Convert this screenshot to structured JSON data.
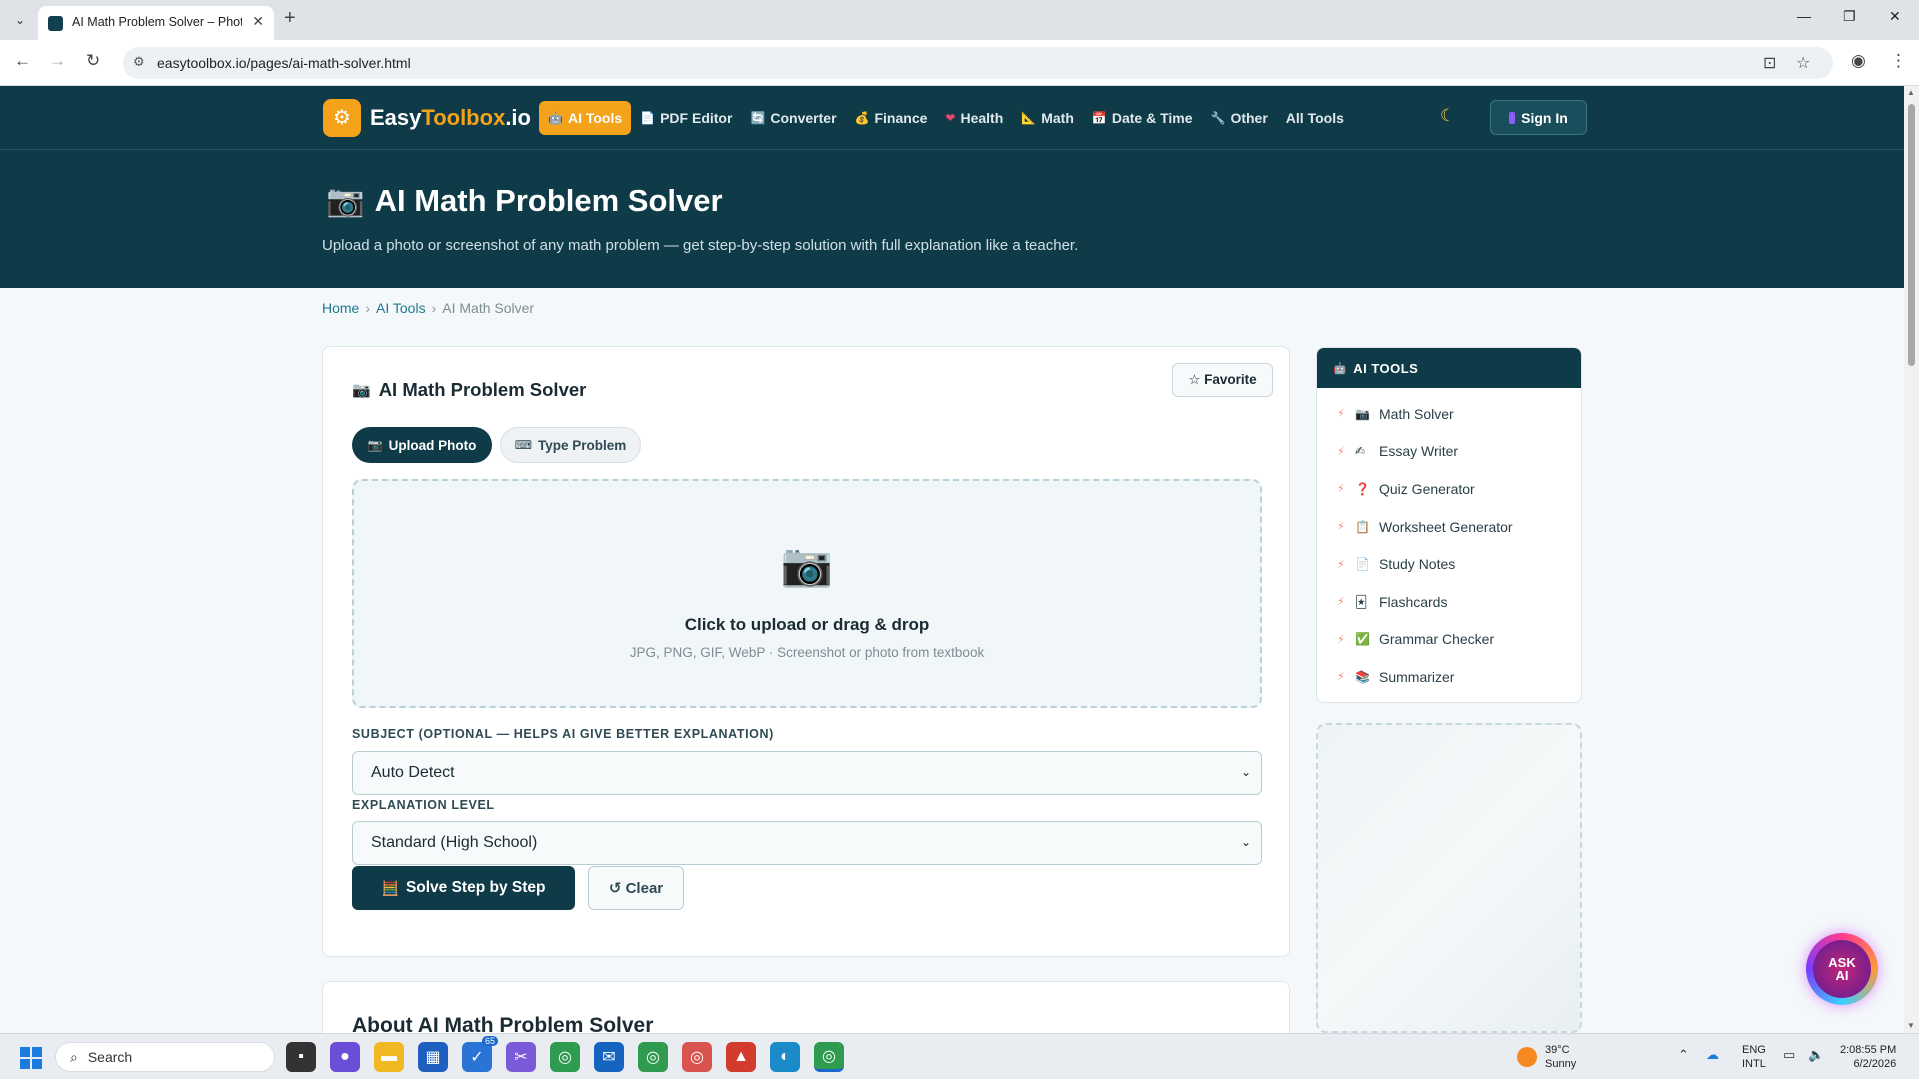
{
  "browser": {
    "tab_title": "AI Math Problem Solver – Photo",
    "url": "easytoolbox.io/pages/ai-math-solver.html"
  },
  "site": {
    "logo_prefix": "Easy",
    "logo_accent": "Toolbox",
    "logo_suffix": ".io",
    "nav": [
      {
        "label": "AI Tools",
        "icon": "🤖",
        "active": true
      },
      {
        "label": "PDF Editor",
        "icon": "📄"
      },
      {
        "label": "Converter",
        "icon": "🔄"
      },
      {
        "label": "Finance",
        "icon": "💰"
      },
      {
        "label": "Health",
        "icon": "❤"
      },
      {
        "label": "Math",
        "icon": "📐"
      },
      {
        "label": "Date & Time",
        "icon": "📅"
      },
      {
        "label": "Other",
        "icon": "🔧"
      },
      {
        "label": "All Tools",
        "icon": ""
      }
    ],
    "sign_in": "Sign In",
    "colors": {
      "brand_dark": "#0f3a47",
      "accent": "#f5a21b"
    }
  },
  "hero": {
    "icon": "📷",
    "title": "AI Math Problem Solver",
    "subtitle": "Upload a photo or screenshot of any math problem — get step-by-step solution with full explanation like a teacher."
  },
  "breadcrumb": {
    "home": "Home",
    "section": "AI Tools",
    "current": "AI Math Solver"
  },
  "tool": {
    "icon": "📷",
    "title": "AI Math Problem Solver",
    "favorite": "☆ Favorite",
    "tabs": [
      {
        "label": "Upload Photo",
        "icon": "📷",
        "active": true
      },
      {
        "label": "Type Problem",
        "icon": "⌨",
        "active": false
      }
    ],
    "upload": {
      "icon": "📷",
      "title": "Click to upload or drag & drop",
      "hint": "JPG, PNG, GIF, WebP · Screenshot or photo from textbook"
    },
    "subject_label": "SUBJECT (OPTIONAL — HELPS AI GIVE BETTER EXPLANATION)",
    "subject_value": "Auto Detect",
    "level_label": "EXPLANATION LEVEL",
    "level_value": "Standard (High School)",
    "solve_label": "Solve Step by Step",
    "solve_icon": "🧮",
    "clear_label": "↺ Clear"
  },
  "about": {
    "title": "About AI Math Problem Solver"
  },
  "sidebar": {
    "heading": "AI TOOLS",
    "heading_icon": "🤖",
    "items": [
      {
        "label": "Math Solver",
        "icon": "📷"
      },
      {
        "label": "Essay Writer",
        "icon": "✍"
      },
      {
        "label": "Quiz Generator",
        "icon": "❓"
      },
      {
        "label": "Worksheet Generator",
        "icon": "📋"
      },
      {
        "label": "Study Notes",
        "icon": "📄"
      },
      {
        "label": "Flashcards",
        "icon": "🃏"
      },
      {
        "label": "Grammar Checker",
        "icon": "✅"
      },
      {
        "label": "Summarizer",
        "icon": "📚"
      }
    ]
  },
  "ask_ai": {
    "line1": "ASK",
    "line2": "AI"
  },
  "taskbar": {
    "search_placeholder": "Search",
    "badge": "65",
    "weather_temp": "39°C",
    "weather_desc": "Sunny",
    "lang_line1": "ENG",
    "lang_line2": "INTL",
    "time": "2:08:55 PM",
    "date": "6/2/2026"
  }
}
